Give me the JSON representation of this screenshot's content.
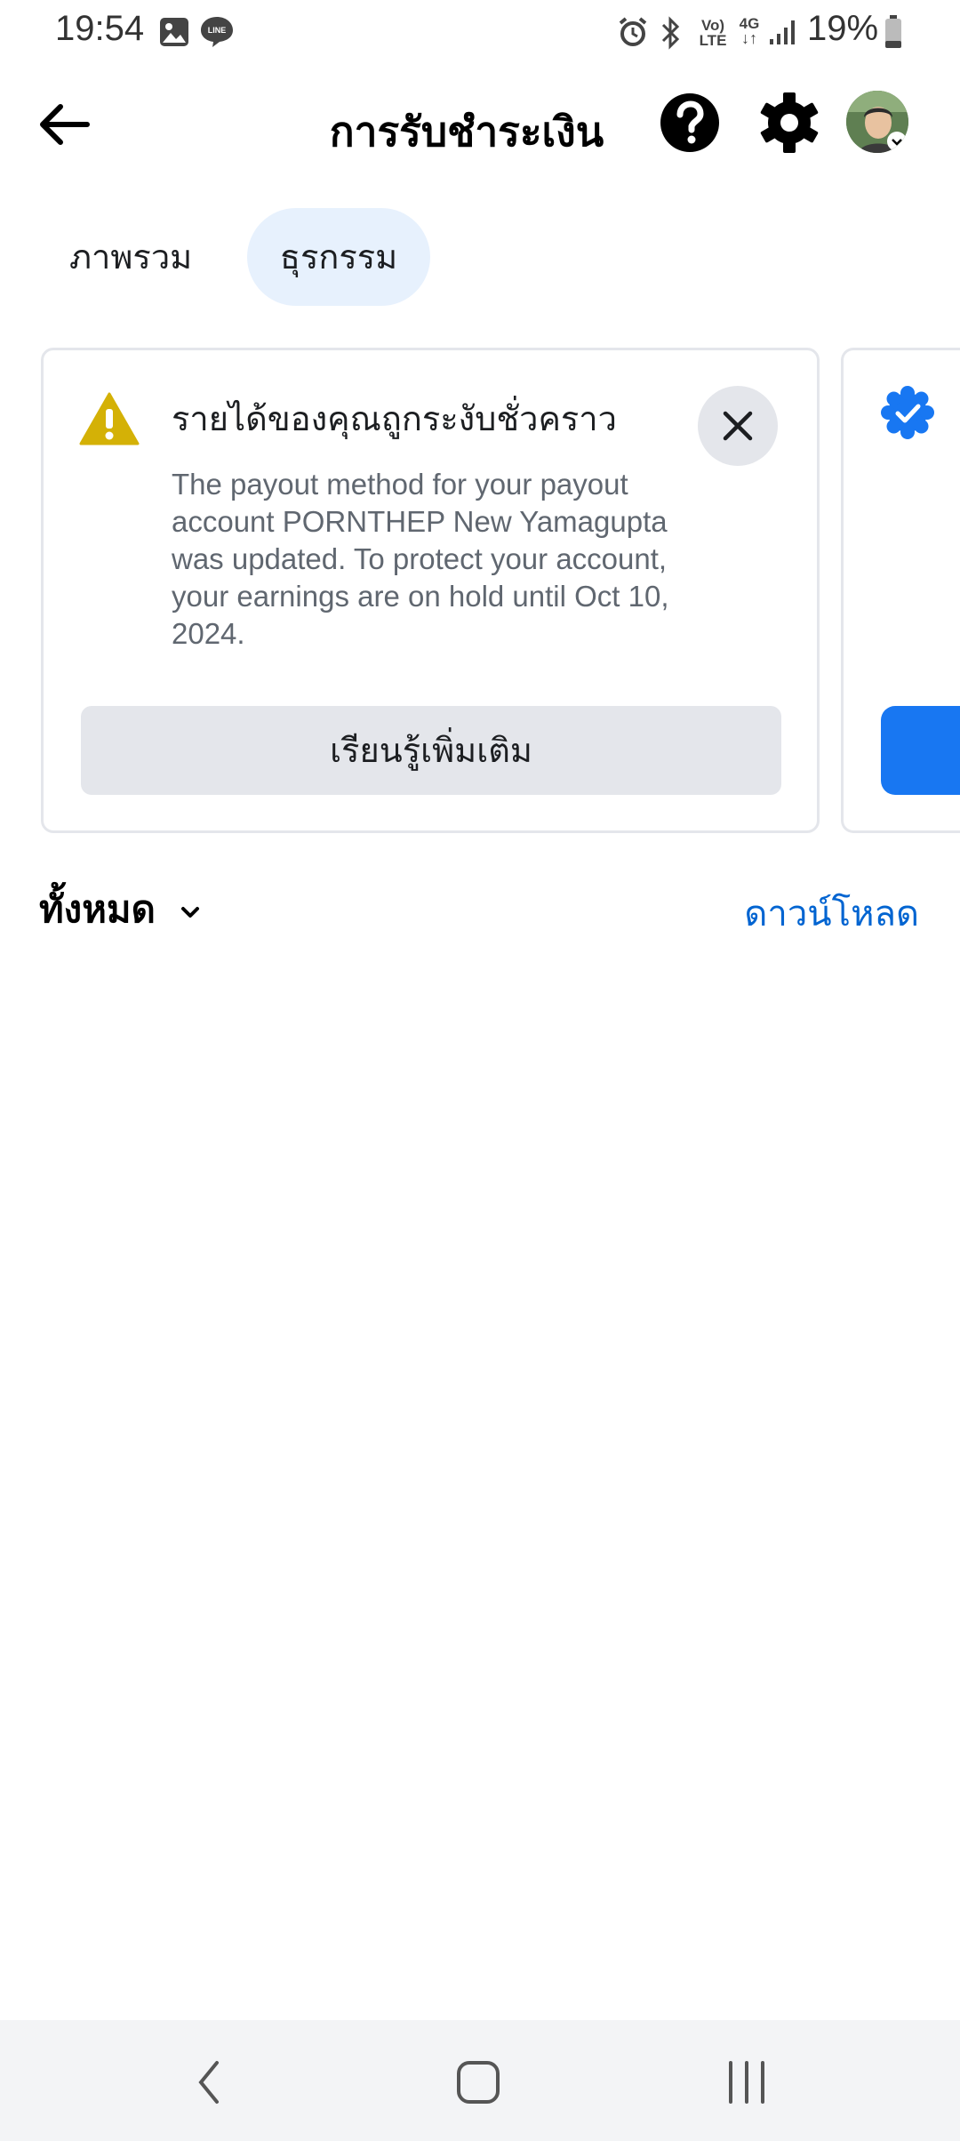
{
  "status_bar": {
    "time": "19:54",
    "battery": "19%",
    "volte_top": "Vo)",
    "volte_bottom": "LTE",
    "network": "4G",
    "icons": [
      "gallery-icon",
      "line-app-icon",
      "alarm-icon",
      "bluetooth-icon",
      "volte-icon",
      "network-4g-icon",
      "signal-icon",
      "battery-icon"
    ],
    "line_badge": "LINE"
  },
  "header": {
    "title": "การรับชำระเงิน",
    "icons": [
      "back-arrow-icon",
      "help-icon",
      "gear-icon",
      "avatar"
    ]
  },
  "tabs": [
    {
      "label": "ภาพรวม",
      "selected": false
    },
    {
      "label": "ธุรกรรม",
      "selected": true
    }
  ],
  "alert_card": {
    "title": "รายได้ของคุณถูกระงับชั่วคราว",
    "body": "The payout method for your payout account PORNTHEP New Yamagupta was updated. To protect your account, your earnings are on hold until Oct 10, 2024.",
    "button_label": "เรียนรู้เพิ่มเติม",
    "icon": "warning-icon"
  },
  "filter": {
    "label": "ทั้งหมด"
  },
  "download_label": "ดาวน์โหลด",
  "colors": {
    "accent": "#1877f2",
    "link": "#0064d1",
    "warning": "#d4b106",
    "tab_selected_bg": "#e7f1fd"
  }
}
